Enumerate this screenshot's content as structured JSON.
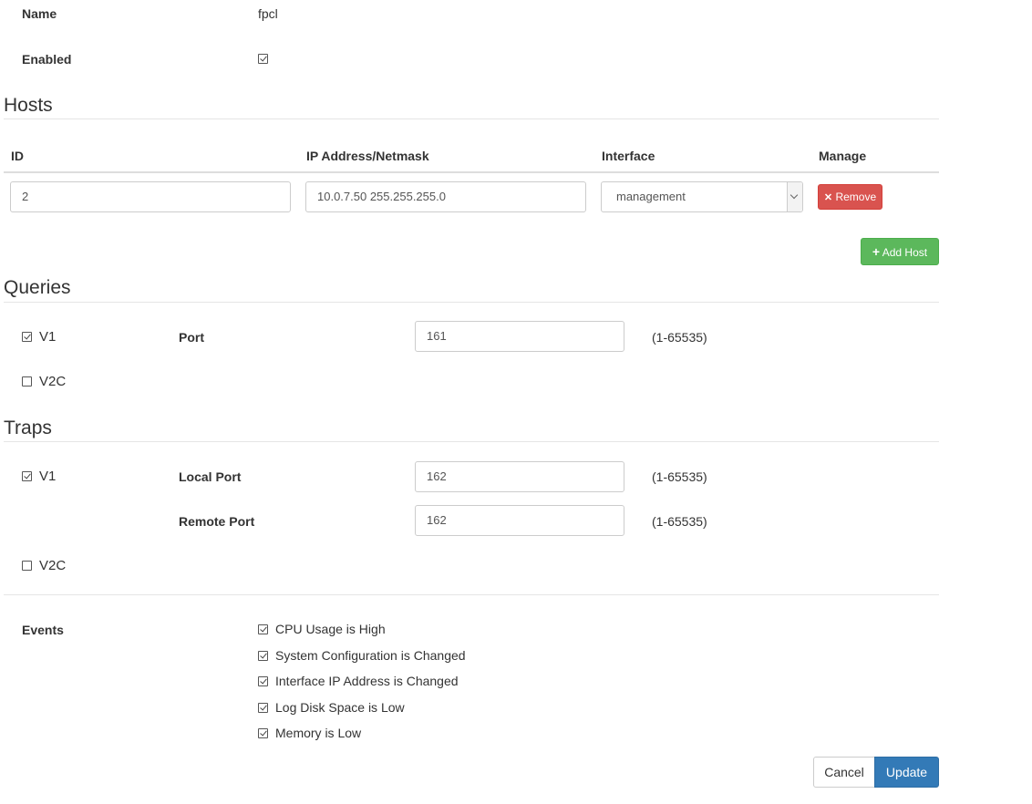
{
  "general": {
    "name_label": "Name",
    "name_value": "fpcl",
    "enabled_label": "Enabled",
    "enabled_checked": true
  },
  "hosts": {
    "title": "Hosts",
    "columns": [
      "ID",
      "IP Address/Netmask",
      "Interface",
      "Manage"
    ],
    "rows": [
      {
        "id": "2",
        "ip": "10.0.7.50 255.255.255.0",
        "interface": "management",
        "remove_label": "Remove"
      }
    ],
    "add_host_label": "Add Host"
  },
  "queries": {
    "title": "Queries",
    "v1_label": "V1",
    "v1_checked": true,
    "v2c_label": "V2C",
    "v2c_checked": false,
    "port_label": "Port",
    "port_value": "161",
    "port_range": "(1-65535)"
  },
  "traps": {
    "title": "Traps",
    "v1_label": "V1",
    "v1_checked": true,
    "v2c_label": "V2C",
    "v2c_checked": false,
    "local_port_label": "Local Port",
    "local_port_value": "162",
    "local_port_range": "(1-65535)",
    "remote_port_label": "Remote Port",
    "remote_port_value": "162",
    "remote_port_range": "(1-65535)"
  },
  "events": {
    "label": "Events",
    "items": [
      {
        "label": "CPU Usage is High",
        "checked": true
      },
      {
        "label": "System Configuration is Changed",
        "checked": true
      },
      {
        "label": "Interface IP Address is Changed",
        "checked": true
      },
      {
        "label": "Log Disk Space is Low",
        "checked": true
      },
      {
        "label": "Memory is Low",
        "checked": true
      }
    ]
  },
  "footer": {
    "cancel_label": "Cancel",
    "update_label": "Update"
  }
}
